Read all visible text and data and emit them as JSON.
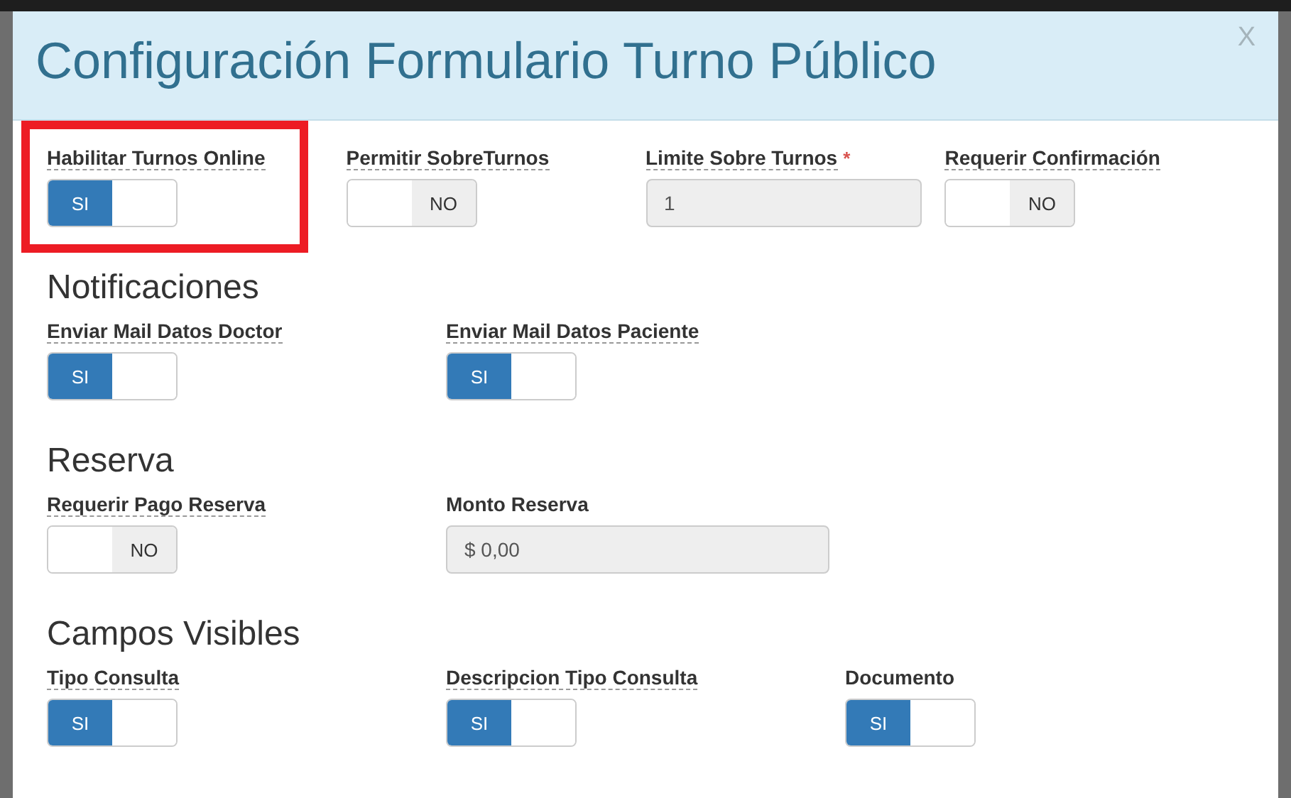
{
  "modal": {
    "title": "Configuración Formulario Turno Público",
    "close": "X"
  },
  "sections": [
    {
      "rows": [
        {
          "items": [
            {
              "kind": "toggle",
              "label": "Habilitar Turnos Online",
              "hint": true,
              "on": true,
              "text": "SI",
              "highlighted": true
            },
            {
              "kind": "toggle",
              "label": "Permitir SobreTurnos",
              "hint": true,
              "on": false,
              "text": "NO"
            },
            {
              "kind": "input",
              "label": "Limite Sobre Turnos",
              "hint": true,
              "required_mark": "*",
              "value": "1",
              "disabled": true
            },
            {
              "kind": "toggle",
              "label": "Requerir Confirmación",
              "hint": true,
              "on": false,
              "text": "NO"
            }
          ]
        }
      ]
    },
    {
      "heading": "Notificaciones",
      "rows": [
        {
          "items": [
            {
              "kind": "toggle",
              "label": "Enviar Mail Datos Doctor",
              "hint": true,
              "on": true,
              "text": "SI"
            },
            {
              "kind": "toggle",
              "label": "Enviar Mail Datos Paciente",
              "hint": true,
              "on": true,
              "text": "SI"
            }
          ]
        }
      ]
    },
    {
      "heading": "Reserva",
      "rows": [
        {
          "items": [
            {
              "kind": "toggle",
              "label": "Requerir Pago Reserva",
              "hint": true,
              "on": false,
              "text": "NO"
            },
            {
              "kind": "input",
              "label": "Monto Reserva",
              "hint": false,
              "value": "$ 0,00",
              "disabled": true
            }
          ]
        }
      ]
    },
    {
      "heading": "Campos Visibles",
      "rows": [
        {
          "items": [
            {
              "kind": "toggle",
              "label": "Tipo Consulta",
              "hint": true,
              "on": true,
              "text": "SI"
            },
            {
              "kind": "toggle",
              "label": "Descripcion Tipo Consulta",
              "hint": true,
              "on": true,
              "text": "SI"
            },
            {
              "kind": "toggle",
              "label": "Documento",
              "hint": false,
              "on": true,
              "text": "SI"
            }
          ]
        }
      ]
    }
  ]
}
